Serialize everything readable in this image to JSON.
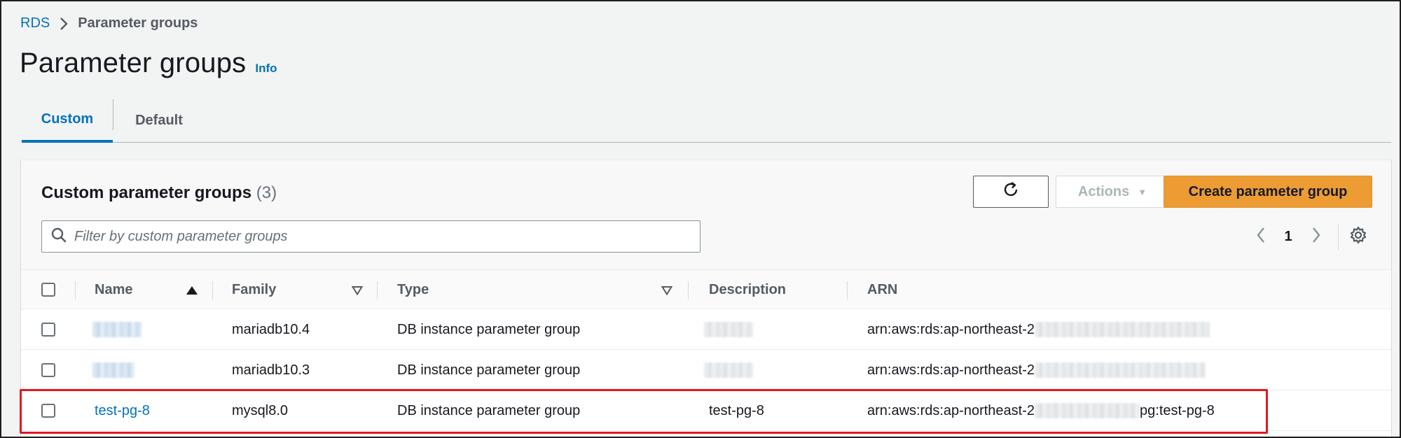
{
  "breadcrumb": {
    "root": "RDS",
    "current": "Parameter groups"
  },
  "page": {
    "title": "Parameter groups",
    "info_label": "Info"
  },
  "tabs": [
    {
      "label": "Custom",
      "active": true
    },
    {
      "label": "Default",
      "active": false
    }
  ],
  "panel": {
    "title": "Custom parameter groups",
    "count": "(3)",
    "actions_label": "Actions",
    "create_label": "Create parameter group",
    "search_placeholder": "Filter by custom parameter groups",
    "current_page": "1"
  },
  "table": {
    "columns": [
      "Name",
      "Family",
      "Type",
      "Description",
      "ARN"
    ],
    "rows": [
      {
        "name": "",
        "family": "mariadb10.4",
        "type": "DB instance parameter group",
        "description": "",
        "arn_prefix": "arn:aws:rds:ap-northeast-2",
        "arn_suffix": ""
      },
      {
        "name": "",
        "family": "mariadb10.3",
        "type": "DB instance parameter group",
        "description": "",
        "arn_prefix": "arn:aws:rds:ap-northeast-2",
        "arn_suffix": ""
      },
      {
        "name": "test-pg-8",
        "family": "mysql8.0",
        "type": "DB instance parameter group",
        "description": "test-pg-8",
        "arn_prefix": "arn:aws:rds:ap-northeast-2",
        "arn_suffix": "pg:test-pg-8"
      }
    ]
  },
  "colors": {
    "link": "#0073bb",
    "primary_button": "#ec9c33",
    "highlight": "#e4171d"
  }
}
